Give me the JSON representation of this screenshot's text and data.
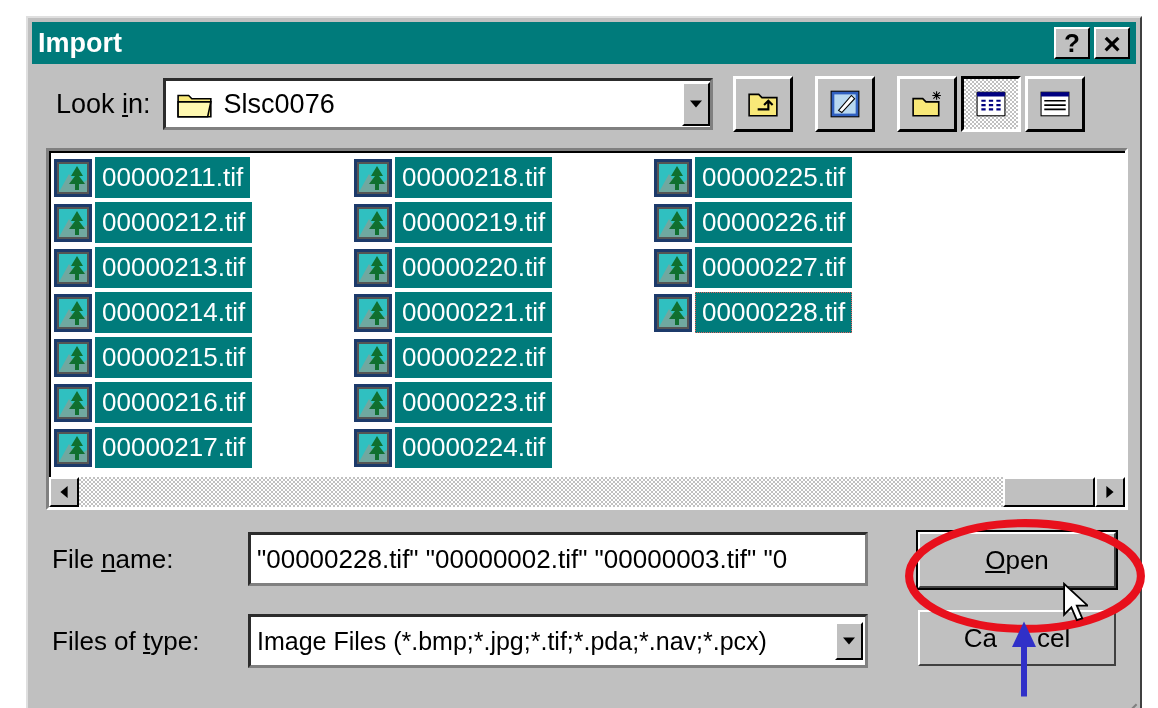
{
  "window": {
    "title": "Import",
    "help_button": "?",
    "close_button": "×"
  },
  "look_in": {
    "label": [
      "Look ",
      "i",
      "n:"
    ],
    "value": "Slsc0076"
  },
  "toolbar": [
    {
      "kind": "up-folder",
      "pressed": false
    },
    {
      "kind": "desktop",
      "pressed": false
    },
    {
      "kind": "new-folder",
      "pressed": false
    },
    {
      "kind": "list-view",
      "pressed": true
    },
    {
      "kind": "details-view",
      "pressed": false
    }
  ],
  "files": [
    {
      "name": "00000211.tif",
      "selected": true,
      "focused": false
    },
    {
      "name": "00000212.tif",
      "selected": true,
      "focused": false
    },
    {
      "name": "00000213.tif",
      "selected": true,
      "focused": false
    },
    {
      "name": "00000214.tif",
      "selected": true,
      "focused": false
    },
    {
      "name": "00000215.tif",
      "selected": true,
      "focused": false
    },
    {
      "name": "00000216.tif",
      "selected": true,
      "focused": false
    },
    {
      "name": "00000217.tif",
      "selected": true,
      "focused": false
    },
    {
      "name": "00000218.tif",
      "selected": true,
      "focused": false
    },
    {
      "name": "00000219.tif",
      "selected": true,
      "focused": false
    },
    {
      "name": "00000220.tif",
      "selected": true,
      "focused": false
    },
    {
      "name": "00000221.tif",
      "selected": true,
      "focused": false
    },
    {
      "name": "00000222.tif",
      "selected": true,
      "focused": false
    },
    {
      "name": "00000223.tif",
      "selected": true,
      "focused": false
    },
    {
      "name": "00000224.tif",
      "selected": true,
      "focused": false
    },
    {
      "name": "00000225.tif",
      "selected": true,
      "focused": false
    },
    {
      "name": "00000226.tif",
      "selected": true,
      "focused": false
    },
    {
      "name": "00000227.tif",
      "selected": true,
      "focused": false
    },
    {
      "name": "00000228.tif",
      "selected": true,
      "focused": true
    }
  ],
  "file_name": {
    "label": [
      "File ",
      "n",
      "ame:"
    ],
    "value": "\"00000228.tif\" \"00000002.tif\" \"00000003.tif\" \"0"
  },
  "files_of_type": {
    "label": [
      "Files of ",
      "t",
      "ype:"
    ],
    "value": "Image Files (*.bmp;*.jpg;*.tif;*.pda;*.nav;*.pcx)"
  },
  "buttons": [
    {
      "key": "O",
      "rest": "pen"
    },
    {
      "visible_parts": [
        "Ca",
        "cel"
      ]
    }
  ]
}
